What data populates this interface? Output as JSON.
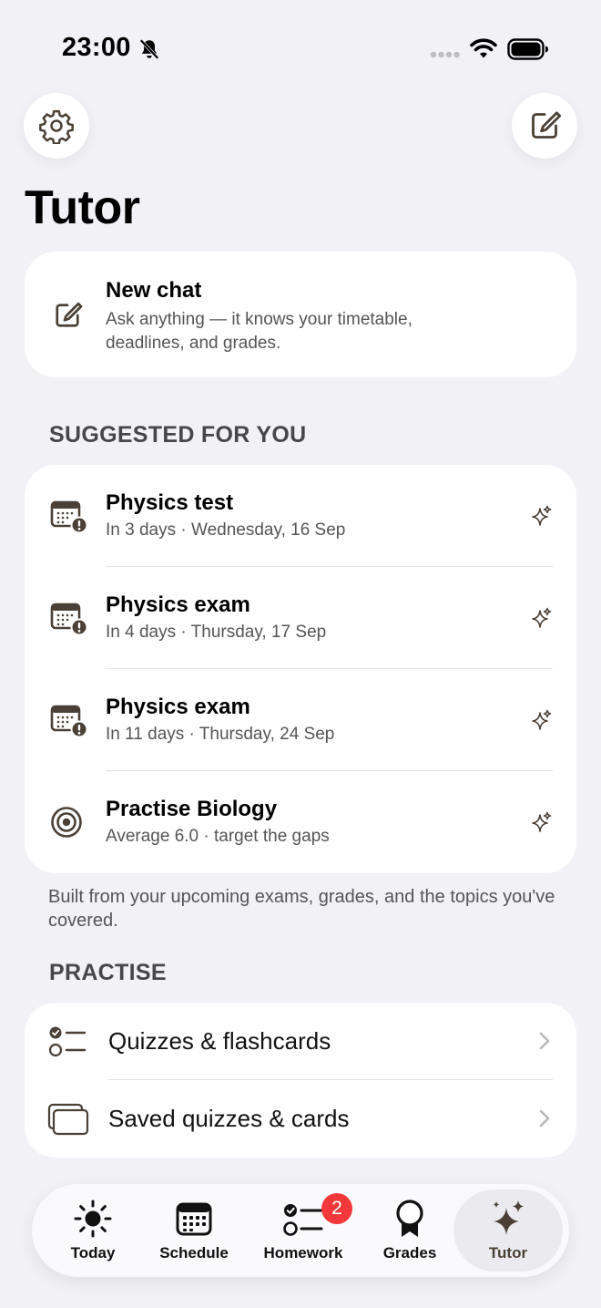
{
  "status": {
    "time": "23:00"
  },
  "header": {
    "title": "Tutor"
  },
  "new_chat": {
    "title": "New chat",
    "subtitle": "Ask anything — it knows your timetable, deadlines, and grades."
  },
  "suggested": {
    "header": "SUGGESTED FOR YOU",
    "items": [
      {
        "title": "Physics test",
        "subtitle": "In 3 days · Wednesday, 16 Sep",
        "icon": "calendar-alert-icon"
      },
      {
        "title": "Physics exam",
        "subtitle": "In 4 days · Thursday, 17 Sep",
        "icon": "calendar-alert-icon"
      },
      {
        "title": "Physics exam",
        "subtitle": "In 11 days · Thursday, 24 Sep",
        "icon": "calendar-alert-icon"
      },
      {
        "title": "Practise Biology",
        "subtitle": "Average 6.0 · target the gaps",
        "icon": "target-icon"
      }
    ],
    "footnote": "Built from your upcoming exams, grades, and the topics you've covered."
  },
  "practise": {
    "header": "PRACTISE",
    "items": [
      {
        "label": "Quizzes & flashcards",
        "icon": "checklist-icon"
      },
      {
        "label": "Saved quizzes & cards",
        "icon": "cards-stack-icon"
      }
    ]
  },
  "tabs": [
    {
      "label": "Today",
      "icon": "sun-icon"
    },
    {
      "label": "Schedule",
      "icon": "calendar-icon"
    },
    {
      "label": "Homework",
      "icon": "checklist-icon",
      "badge": "2"
    },
    {
      "label": "Grades",
      "icon": "award-ribbon-icon"
    },
    {
      "label": "Tutor",
      "icon": "sparkles-icon",
      "selected": true
    }
  ],
  "colors": {
    "background": "#f2f2f6",
    "accent": "#4a4036",
    "badge": "#f2383b"
  }
}
